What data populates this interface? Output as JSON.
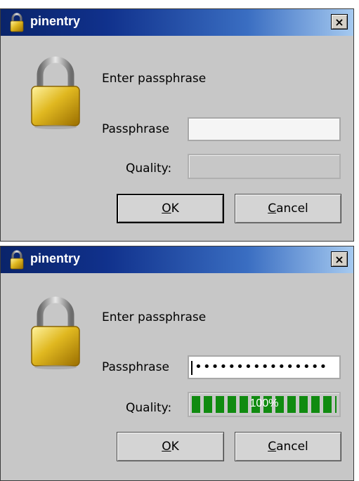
{
  "dialogs": [
    {
      "title": "pinentry",
      "close_glyph": "×",
      "prompt": "Enter passphrase",
      "passphrase_label": "Passphrase",
      "passphrase_value": "",
      "quality_label": "Quality:",
      "quality_percent": 0,
      "quality_text": "",
      "ok_accel": "O",
      "ok_rest": "K",
      "cancel_accel": "C",
      "cancel_rest": "ancel"
    },
    {
      "title": "pinentry",
      "close_glyph": "×",
      "prompt": "Enter passphrase",
      "passphrase_label": "Passphrase",
      "passphrase_value": "••••••••••••••••",
      "quality_label": "Quality:",
      "quality_percent": 100,
      "quality_text": "100%",
      "ok_accel": "O",
      "ok_rest": "K",
      "cancel_accel": "C",
      "cancel_rest": "ancel"
    }
  ],
  "icons": {
    "titlebar": "padlock-icon",
    "dialog": "padlock-icon"
  },
  "colors": {
    "titlebar_start": "#0a246a",
    "titlebar_end": "#a6caf0",
    "quality_fill": "#108b10",
    "dialog_bg": "#c7c7c7"
  }
}
